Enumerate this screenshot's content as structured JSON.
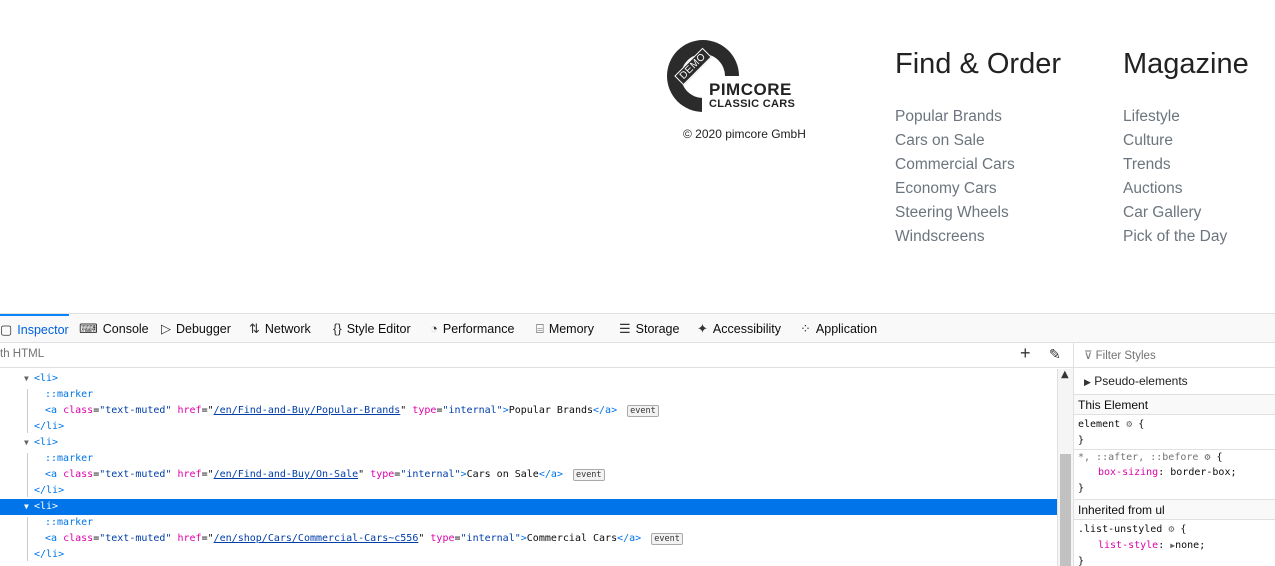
{
  "site": {
    "logo": {
      "demo": "DEMO",
      "name": "PIMCORE",
      "tagline": "CLASSIC CARS"
    },
    "copyright": "© 2020 pimcore GmbH",
    "find_order": {
      "title": "Find & Order",
      "links": [
        "Popular Brands",
        "Cars on Sale",
        "Commercial Cars",
        "Economy Cars",
        "Steering Wheels",
        "Windscreens"
      ]
    },
    "magazine": {
      "title": "Magazine",
      "links": [
        "Lifestyle",
        "Culture",
        "Trends",
        "Auctions",
        "Car Gallery",
        "Pick of the Day"
      ]
    }
  },
  "devtools": {
    "tabs": [
      "Inspector",
      "Console",
      "Debugger",
      "Network",
      "Style Editor",
      "Performance",
      "Memory",
      "Storage",
      "Accessibility",
      "Application"
    ],
    "search_placeholder": "th HTML",
    "filter_styles_placeholder": "Filter Styles",
    "markup": {
      "li_open": "<li>",
      "li_close": "</li>",
      "marker": "::marker",
      "a_open": "<a",
      "class_attr": "class",
      "class_val": "\"text-muted\"",
      "href_attr": "href",
      "type_attr": "type",
      "type_val": "\"internal\"",
      "a_close": "</a>",
      "event": "event",
      "items": [
        {
          "href": "/en/Find-and-Buy/Popular-Brands",
          "text": "Popular Brands"
        },
        {
          "href": "/en/Find-and-Buy/On-Sale",
          "text": "Cars on Sale"
        },
        {
          "href": "/en/shop/Cars/Commercial-Cars~c556",
          "text": "Commercial Cars"
        }
      ]
    },
    "rules": {
      "pseudo_elements": "Pseudo-elements",
      "this_element": "This Element",
      "element_selector": "element",
      "universal_selector": "*, ::after, ::before",
      "box_sizing_prop": "box-sizing",
      "box_sizing_val": "border-box",
      "inherited": "Inherited from ul",
      "list_selector": ".list-unstyled",
      "list_style_prop": "list-style",
      "list_style_val": "none"
    }
  }
}
